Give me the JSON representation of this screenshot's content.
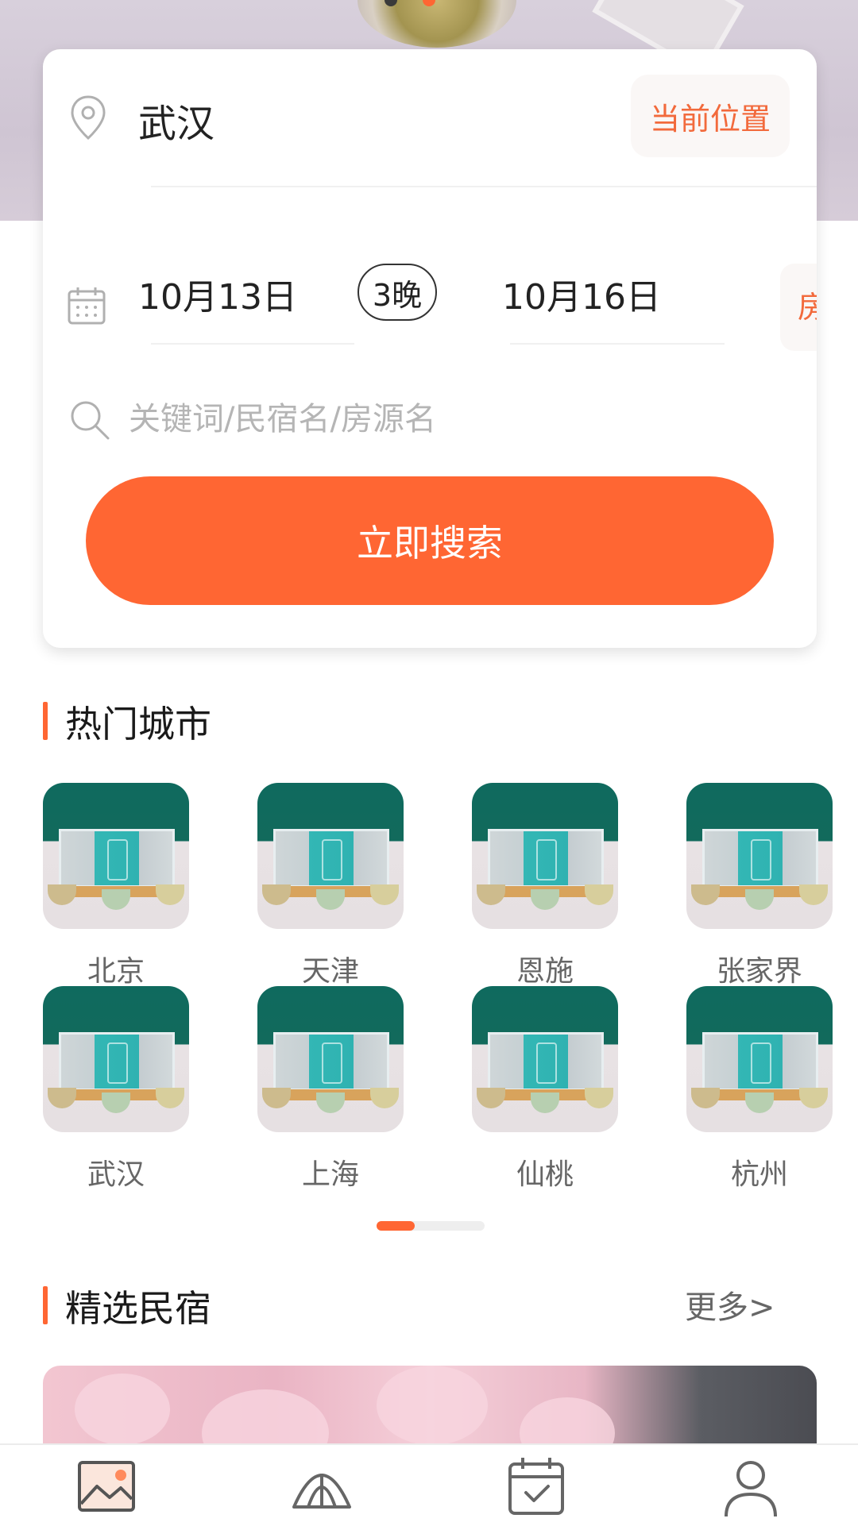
{
  "location": {
    "city": "武汉",
    "current_position_label": "当前位置"
  },
  "dates": {
    "check_in": "10月13日",
    "nights": "3晚",
    "check_out": "10月16日",
    "room_partial": "房"
  },
  "search": {
    "placeholder": "关键词/民宿名/房源名",
    "button_label": "立即搜索"
  },
  "hot_cities": {
    "title": "热门城市",
    "cities": [
      "北京",
      "天津",
      "恩施",
      "张家界",
      "武汉",
      "上海",
      "仙桃",
      "杭州"
    ]
  },
  "featured": {
    "title": "精选民宿",
    "more_label": "更多>"
  },
  "tabbar": {
    "items": [
      "home-image-icon",
      "tent-icon",
      "calendar-check-icon",
      "user-icon"
    ]
  },
  "colors": {
    "accent": "#ff6633",
    "accent_text": "#f26a3c"
  }
}
